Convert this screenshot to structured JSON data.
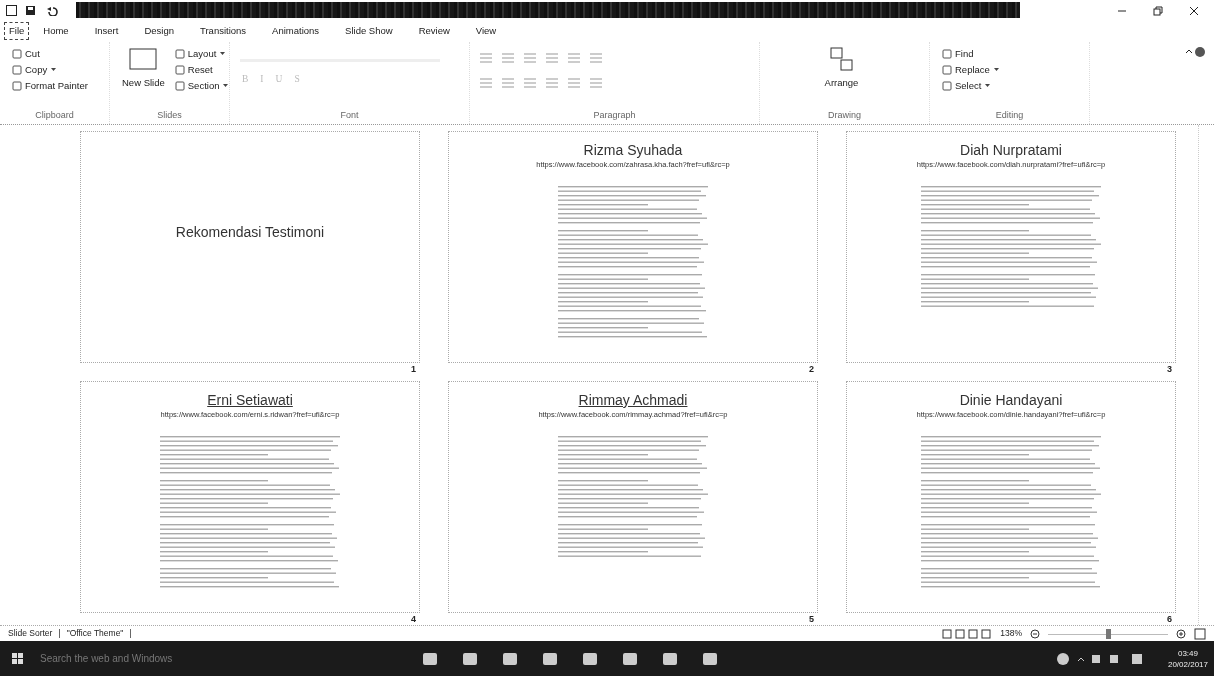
{
  "ribbon": {
    "tabs": [
      {
        "label": "File",
        "selected": true
      },
      {
        "label": "Home",
        "selected": false
      },
      {
        "label": "Insert",
        "selected": false
      },
      {
        "label": "Design",
        "selected": false
      },
      {
        "label": "Transitions",
        "selected": false
      },
      {
        "label": "Animations",
        "selected": false
      },
      {
        "label": "Slide Show",
        "selected": false
      },
      {
        "label": "Review",
        "selected": false
      },
      {
        "label": "View",
        "selected": false
      }
    ],
    "groups": [
      {
        "label": "Clipboard",
        "kind": "stack",
        "buttons": [
          {
            "label": "Cut"
          },
          {
            "label": "Copy",
            "dropdown": true
          },
          {
            "label": "Format Painter"
          }
        ]
      },
      {
        "label": "Slides",
        "kind": "slides",
        "big": "New Slide",
        "buttons": [
          {
            "label": "Layout",
            "dropdown": true
          },
          {
            "label": "Reset"
          },
          {
            "label": "Section",
            "dropdown": true
          }
        ]
      },
      {
        "label": "Font",
        "kind": "font",
        "buttons": [
          {
            "label": "B",
            "disabled": true
          },
          {
            "label": "I",
            "disabled": true
          },
          {
            "label": "U",
            "disabled": true
          },
          {
            "label": "S",
            "disabled": true
          }
        ]
      },
      {
        "label": "Paragraph",
        "kind": "paragraph"
      },
      {
        "label": "Drawing",
        "kind": "drawing",
        "big": "Arrange"
      },
      {
        "label": "Editing",
        "kind": "stack",
        "buttons": [
          {
            "label": "Find"
          },
          {
            "label": "Replace",
            "dropdown": true
          },
          {
            "label": "Select",
            "dropdown": true
          }
        ]
      }
    ]
  },
  "slides": [
    {
      "number": "1",
      "kind": "title",
      "title": "Rekomendasi Testimoni"
    },
    {
      "number": "2",
      "kind": "testimonial",
      "name": "Rizma Syuhada",
      "url": "https://www.facebook.com/zahrasa.kha.fach?fref=ufi&rc=p",
      "name_underlined": false
    },
    {
      "number": "3",
      "kind": "testimonial",
      "name": "Diah Nurpratami",
      "url": "https://www.facebook.com/diah.nurpratami?fref=ufi&rc=p",
      "name_underlined": false
    },
    {
      "number": "4",
      "kind": "testimonial",
      "name": "Erni Setiawati",
      "url": "https://www.facebook.com/erni.s.ridwan?fref=ufi&rc=p",
      "name_underlined": true
    },
    {
      "number": "5",
      "kind": "testimonial",
      "name": "Rimmay Achmadi",
      "url": "https://www.facebook.com/rimmay.achmad?fref=ufi&rc=p",
      "name_underlined": true
    },
    {
      "number": "6",
      "kind": "testimonial",
      "name": "Dinie Handayani",
      "url": "https://www.facebook.com/dinie.handayani?fref=ufi&rc=p",
      "name_underlined": false
    }
  ],
  "status_bar": {
    "items": [
      "Slide Sorter",
      "|",
      "\"Office Theme\"",
      "|"
    ],
    "zoom": "138%",
    "zoom_slider": {
      "level": 0.5
    }
  },
  "taskbar": {
    "search": {
      "placeholder": "Search the web and Windows"
    },
    "time": "03:49",
    "date": "20/02/2017"
  }
}
